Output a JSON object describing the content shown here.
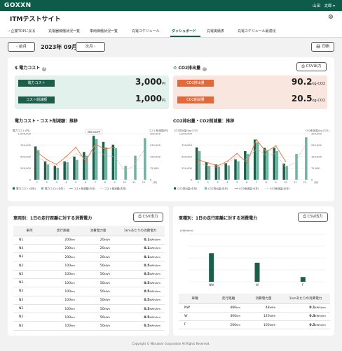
{
  "header": {
    "logo": "GOXXN",
    "user": "山田　太郎 ▾"
  },
  "app": {
    "title": "ITMテストサイト"
  },
  "nav": {
    "back": "‹ 企業TOPに戻る",
    "items": [
      "充電器稼働状況一覧",
      "車両稼働状況一覧",
      "充電スケジュール",
      "ダッシュボード",
      "充電実績表",
      "充電スケジュール最適化"
    ],
    "active_index": 3
  },
  "toolbar": {
    "prev": "‹  前月",
    "month": "2023年 09月",
    "next": "次月  ›",
    "print": "🖨 印刷"
  },
  "cost": {
    "title": "$  電力コスト",
    "rows": [
      {
        "label": "電力コスト",
        "value": "3,000",
        "unit": "円"
      },
      {
        "label": "コスト削減額",
        "value": "1,000",
        "unit": "円"
      }
    ]
  },
  "co2": {
    "title": "CO2排出量",
    "csv": "CSV出力",
    "rows": [
      {
        "label": "CO2排出量",
        "value": "90.2",
        "unit": "kg-CO2"
      },
      {
        "label": "CO2削減量",
        "value": "20.5",
        "unit": "kg-CO2"
      }
    ]
  },
  "chart_data": [
    {
      "type": "bar",
      "title": "電力コスト・コスト削減額：推移",
      "ylabel_left": "電力コスト(円)",
      "ylabel_right": "コスト削減額(円)",
      "categories": [
        "1",
        "2",
        "3",
        "4",
        "5",
        "6",
        "7",
        "8",
        "9",
        "10",
        "11",
        "12"
      ],
      "x_unit": "(月)",
      "left_ticks": [
        "1,000,000",
        "750,000",
        "500,000",
        "250,000",
        "0"
      ],
      "right_ticks": [
        "300,000",
        "225,000",
        "150,000",
        "75,000",
        "0"
      ],
      "ylim_left": [
        0,
        1000000
      ],
      "ylim_right": [
        0,
        300000
      ],
      "tooltip": "986,000円",
      "series": [
        {
          "name": "電力コスト(今年)",
          "kind": "bar",
          "axis": "left",
          "color": "#1d5e4b",
          "values": [
            720000,
            400000,
            300000,
            400000,
            500000,
            600000,
            950000,
            820000,
            760000,
            null,
            null,
            null
          ]
        },
        {
          "name": "電力コスト(去年)",
          "kind": "bar",
          "axis": "left",
          "color": "#6fb3a3",
          "values": [
            640000,
            330000,
            260000,
            380000,
            430000,
            520000,
            880000,
            700000,
            680000,
            300000,
            520000,
            900000
          ]
        },
        {
          "name": "コスト削減額(今年)",
          "kind": "line",
          "axis": "right",
          "color": "#e0773c",
          "values": [
            180000,
            130000,
            100000,
            150000,
            210000,
            120000,
            230000,
            200000,
            210000,
            null,
            null,
            null
          ]
        },
        {
          "name": "コスト削減額(去年)",
          "kind": "dashed",
          "axis": "right",
          "color": "#e7a8a0",
          "values": [
            150000,
            110000,
            90000,
            120000,
            170000,
            140000,
            190000,
            160000,
            150000,
            60000,
            90000,
            190000
          ]
        }
      ],
      "legend": "bottom"
    },
    {
      "type": "bar",
      "title": "CO2排出量・CO2削減量：推移",
      "ylabel_left": "CO2排出量(kg-CO2)",
      "ylabel_right": "CO2削減量(kg-CO2)",
      "categories": [
        "1",
        "2",
        "3",
        "4",
        "5",
        "6",
        "7",
        "8",
        "9",
        "10",
        "11",
        "12"
      ],
      "x_unit": "(月)",
      "left_ticks": [
        "1,000,000",
        "750,000",
        "500,000",
        "250,000",
        "0"
      ],
      "right_ticks": [
        "300,000",
        "225,000",
        "150,000",
        "75,000",
        "0"
      ],
      "ylim_left": [
        0,
        1000000
      ],
      "ylim_right": [
        0,
        300000
      ],
      "series": [
        {
          "name": "CO2排出量(今年)",
          "kind": "bar",
          "axis": "left",
          "color": "#1d5e4b",
          "values": [
            700000,
            380000,
            330000,
            360000,
            440000,
            620000,
            870000,
            690000,
            690000,
            350000,
            null,
            null
          ]
        },
        {
          "name": "CO2排出量(去年)",
          "kind": "bar",
          "axis": "left",
          "color": "#6fb3a3",
          "values": [
            620000,
            300000,
            280000,
            310000,
            400000,
            560000,
            810000,
            640000,
            620000,
            300000,
            560000,
            920000
          ]
        },
        {
          "name": "CO2削減量(今年)",
          "kind": "line",
          "axis": "right",
          "color": "#e0773c",
          "values": [
            130000,
            110000,
            90000,
            120000,
            170000,
            110000,
            260000,
            180000,
            220000,
            120000,
            null,
            null
          ]
        },
        {
          "name": "CO2削減量(去年)",
          "kind": "dashed",
          "axis": "right",
          "color": "#e7a8a0",
          "values": [
            110000,
            90000,
            80000,
            110000,
            150000,
            130000,
            200000,
            160000,
            170000,
            80000,
            110000,
            220000
          ]
        }
      ],
      "legend": "bottom"
    },
    {
      "type": "bar",
      "title": "車種別：1日の走行距離に対する消費電力",
      "ylabel": "(kWh/km)",
      "categories": [
        "NW",
        "W",
        "F"
      ],
      "ylim": [
        0,
        0.3
      ],
      "values": [
        0.18,
        0.12,
        0.03
      ],
      "color": "#1d5e4b"
    }
  ],
  "vehicle_table": {
    "title": "車両別：1日の走行距離に対する消費電力",
    "csv": "CSV出力",
    "headers": [
      "車両",
      "走行距離",
      "消費電力量",
      "1kmあたりの消費電力"
    ],
    "rows": [
      [
        "N1",
        "200",
        "km",
        "20",
        "kWh",
        "0.1",
        "kWh/km"
      ],
      [
        "N4",
        "200",
        "km",
        "20",
        "kWh",
        "0.1",
        "kWh/km"
      ],
      [
        "N3",
        "200",
        "km",
        "20",
        "kWh",
        "0.1",
        "kWh/km"
      ],
      [
        "N2",
        "100",
        "km",
        "50",
        "kWh",
        "0.5",
        "kWh/km"
      ],
      [
        "N2",
        "100",
        "km",
        "50",
        "kWh",
        "0.5",
        "kWh/km"
      ],
      [
        "N2",
        "100",
        "km",
        "50",
        "kWh",
        "0.5",
        "kWh/km"
      ],
      [
        "N2",
        "100",
        "km",
        "50",
        "kWh",
        "0.5",
        "kWh/km"
      ],
      [
        "N2",
        "100",
        "km",
        "50",
        "kWh",
        "0.5",
        "kWh/km"
      ],
      [
        "N2",
        "100",
        "km",
        "50",
        "kWh",
        "0.5",
        "kWh/km"
      ],
      [
        "N2",
        "100",
        "km",
        "50",
        "kWh",
        "0.5",
        "kWh/km"
      ],
      [
        "N2",
        "100",
        "km",
        "50",
        "kWh",
        "0.5",
        "kWh/km"
      ]
    ]
  },
  "type_table": {
    "title": "車種別：1日の走行距離に対する消費電力",
    "csv": "CSV出力",
    "headers": [
      "車種",
      "走行距離",
      "消費電力量",
      "1kmあたりの消費電力"
    ],
    "rows": [
      [
        "NW",
        "480",
        "km",
        "48",
        "kWh",
        "0.1",
        "kWh/km"
      ],
      [
        "W",
        "400",
        "km",
        "120",
        "kWh",
        "0.3",
        "kWh/km"
      ],
      [
        "F",
        "200",
        "km",
        "100",
        "kWh",
        "0.5",
        "kWh/km"
      ]
    ]
  },
  "footer": {
    "copyright": "Copyright © Marubeni Corporation All Rights Reserved."
  },
  "colors": {
    "brand": "#0d5c4a",
    "accent": "#e0773c",
    "teal_light": "#6fb3a3",
    "co2_band": "#f9e6df",
    "cost_band": "#e3f1ec"
  }
}
